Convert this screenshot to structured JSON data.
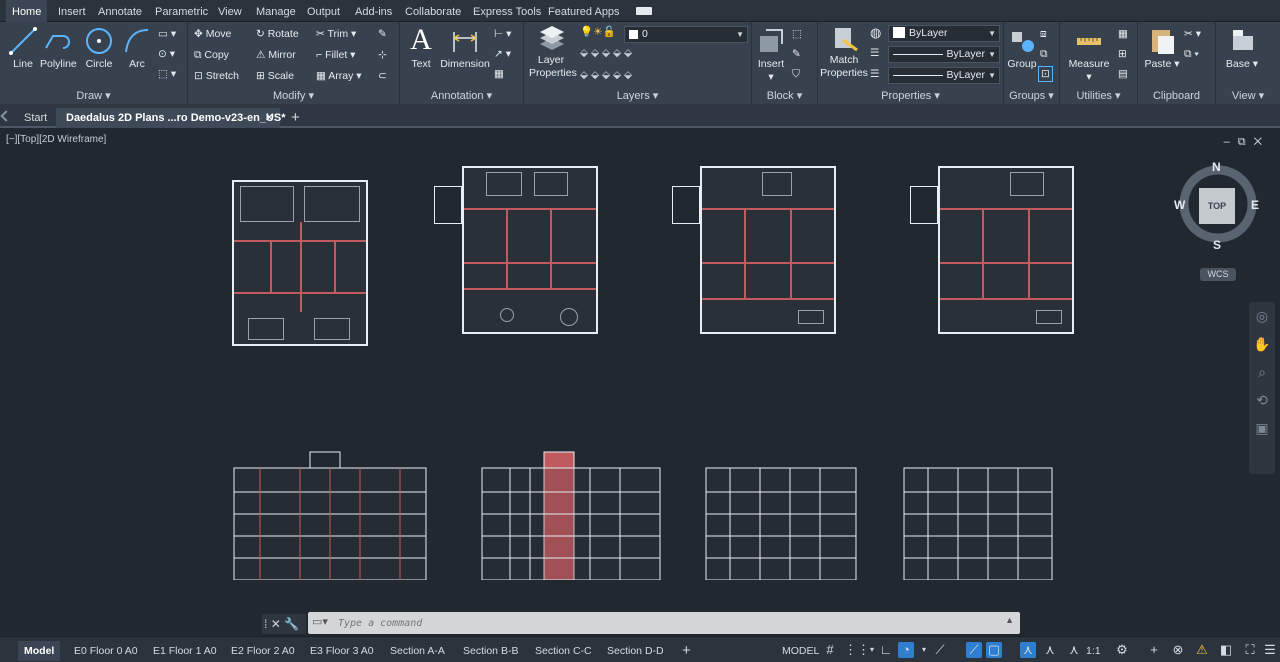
{
  "menu": {
    "tabs": [
      "Home",
      "Insert",
      "Annotate",
      "Parametric",
      "View",
      "Manage",
      "Output",
      "Add-ins",
      "Collaborate",
      "Express Tools",
      "Featured Apps"
    ]
  },
  "ribbon": {
    "draw": {
      "title": "Draw",
      "tools": [
        "Line",
        "Polyline",
        "Circle",
        "Arc"
      ]
    },
    "modify": {
      "title": "Modify",
      "rows": [
        [
          "Move",
          "Rotate",
          "Trim"
        ],
        [
          "Copy",
          "Mirror",
          "Fillet"
        ],
        [
          "Stretch",
          "Scale",
          "Array"
        ]
      ]
    },
    "annotation": {
      "title": "Annotation",
      "tools": [
        "Text",
        "Dimension"
      ]
    },
    "layers": {
      "title": "Layers",
      "tool": "Layer Properties",
      "layer_value": "0"
    },
    "block": {
      "title": "Block",
      "tool": "Insert"
    },
    "properties": {
      "title": "Properties",
      "tool": "Match Properties",
      "color": "ByLayer",
      "linetype": "ByLayer",
      "lineweight": "ByLayer"
    },
    "groups": {
      "title": "Groups",
      "tool": "Group"
    },
    "utilities": {
      "title": "Utilities",
      "tool": "Measure"
    },
    "clipboard": {
      "title": "Clipboard",
      "tool": "Paste"
    },
    "view": {
      "title": "View",
      "tool": "Base"
    }
  },
  "doctabs": {
    "start": "Start",
    "active": "Daedalus 2D Plans ...ro Demo-v23-en_US*"
  },
  "viewport": {
    "label": "[−][Top][2D Wireframe]"
  },
  "viewcube": {
    "n": "N",
    "s": "S",
    "e": "E",
    "w": "W",
    "face": "TOP",
    "wcs": "WCS"
  },
  "command": {
    "placeholder": "Type a command"
  },
  "layouts": [
    "Model",
    "E0 Floor 0 A0",
    "E1 Floor 1 A0",
    "E2 Floor 2 A0",
    "E3 Floor 3 A0",
    "Section A-A",
    "Section B-B",
    "Section C-C",
    "Section D-D"
  ],
  "status": {
    "model": "MODEL",
    "scale": "1:1"
  },
  "colors": {
    "accent": "#2f7fd1",
    "wall": "#c05a5e",
    "line": "#e8eef2"
  }
}
